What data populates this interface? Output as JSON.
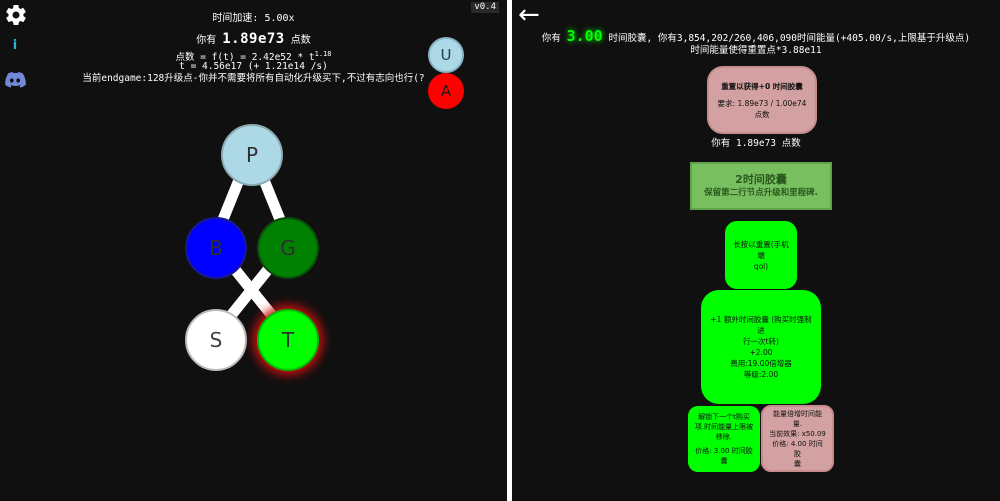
{
  "left": {
    "version": "v0.4",
    "speed_label": "时间加速: 5.00x",
    "points_prefix": "你有 ",
    "points_value": "1.89e73",
    "points_suffix": " 点数",
    "formula_main": "点数 = f(t) = 2.42e52 * t",
    "formula_exp": "1.18",
    "t_line": "t = 4.56e17 (+ 1.21e14 /s)",
    "endgame_note": "当前endgame:128升级点-你并不需要将所有自动化升级买下,不过有志向也行(?",
    "nodes": [
      {
        "key": "p",
        "label": "P",
        "color": "#add8e6"
      },
      {
        "key": "b",
        "label": "B",
        "color": "#0000ff"
      },
      {
        "key": "g",
        "label": "G",
        "color": "#008000"
      },
      {
        "key": "s",
        "label": "S",
        "color": "#ffffff"
      },
      {
        "key": "t",
        "label": "T",
        "color": "#00ff00"
      }
    ],
    "u_button": "U",
    "a_button": "A",
    "icons": {
      "settings": "gear-icon",
      "info": "info-icon",
      "discord": "discord-icon"
    },
    "info_glyph": "i"
  },
  "right": {
    "back_glyph": "←",
    "capsule_prefix": "你有 ",
    "capsule_value": "3.00",
    "capsule_suffix": " 时间胶囊, 你有3,854,202/260,406,090时间能量(+405.00/s,上限基于升级点)",
    "reset_boost_line": "时间能量使得重置点*3.88e11",
    "reset_card": {
      "title": "重置以获得+0 时间胶囊",
      "requirement": "要求: 1.89e73 / 1.00e74",
      "unit": "点数"
    },
    "points_line": "你有 1.89e73 点数",
    "milestone": {
      "title": "2时间胶囊",
      "desc": "保留第二行节点升级和里程碑."
    },
    "hold_card": {
      "line1": "长按以重置(手机端",
      "line2": "qol)"
    },
    "extra_card": {
      "line1": "+1 额外时间胶囊 (购买时强制进",
      "line2": "行一次t转)",
      "line3": "+2.00",
      "line4": "费用:19.00倍增器",
      "line5": "等级:2.00"
    },
    "unlock_card": {
      "line1": "解锁下一个t购买",
      "line2": "项.时间能量上限被",
      "line3": "移除.",
      "line4": "价格: 3.00 时间胶",
      "line5": "囊"
    },
    "energy_card": {
      "line1": "能量倍增时间能量.",
      "line2": "当前效果: x50.09",
      "line3": "价格: 4.00 时间胶",
      "line4": "囊"
    }
  },
  "colors": {
    "background": "#101010",
    "divider": "#ffffff",
    "capsule_green": "#00ff00",
    "milestone_green": "#77bf5f",
    "locked_pink": "#d3a1a1",
    "u_blue": "#add8e6",
    "a_red": "#ff0000"
  }
}
